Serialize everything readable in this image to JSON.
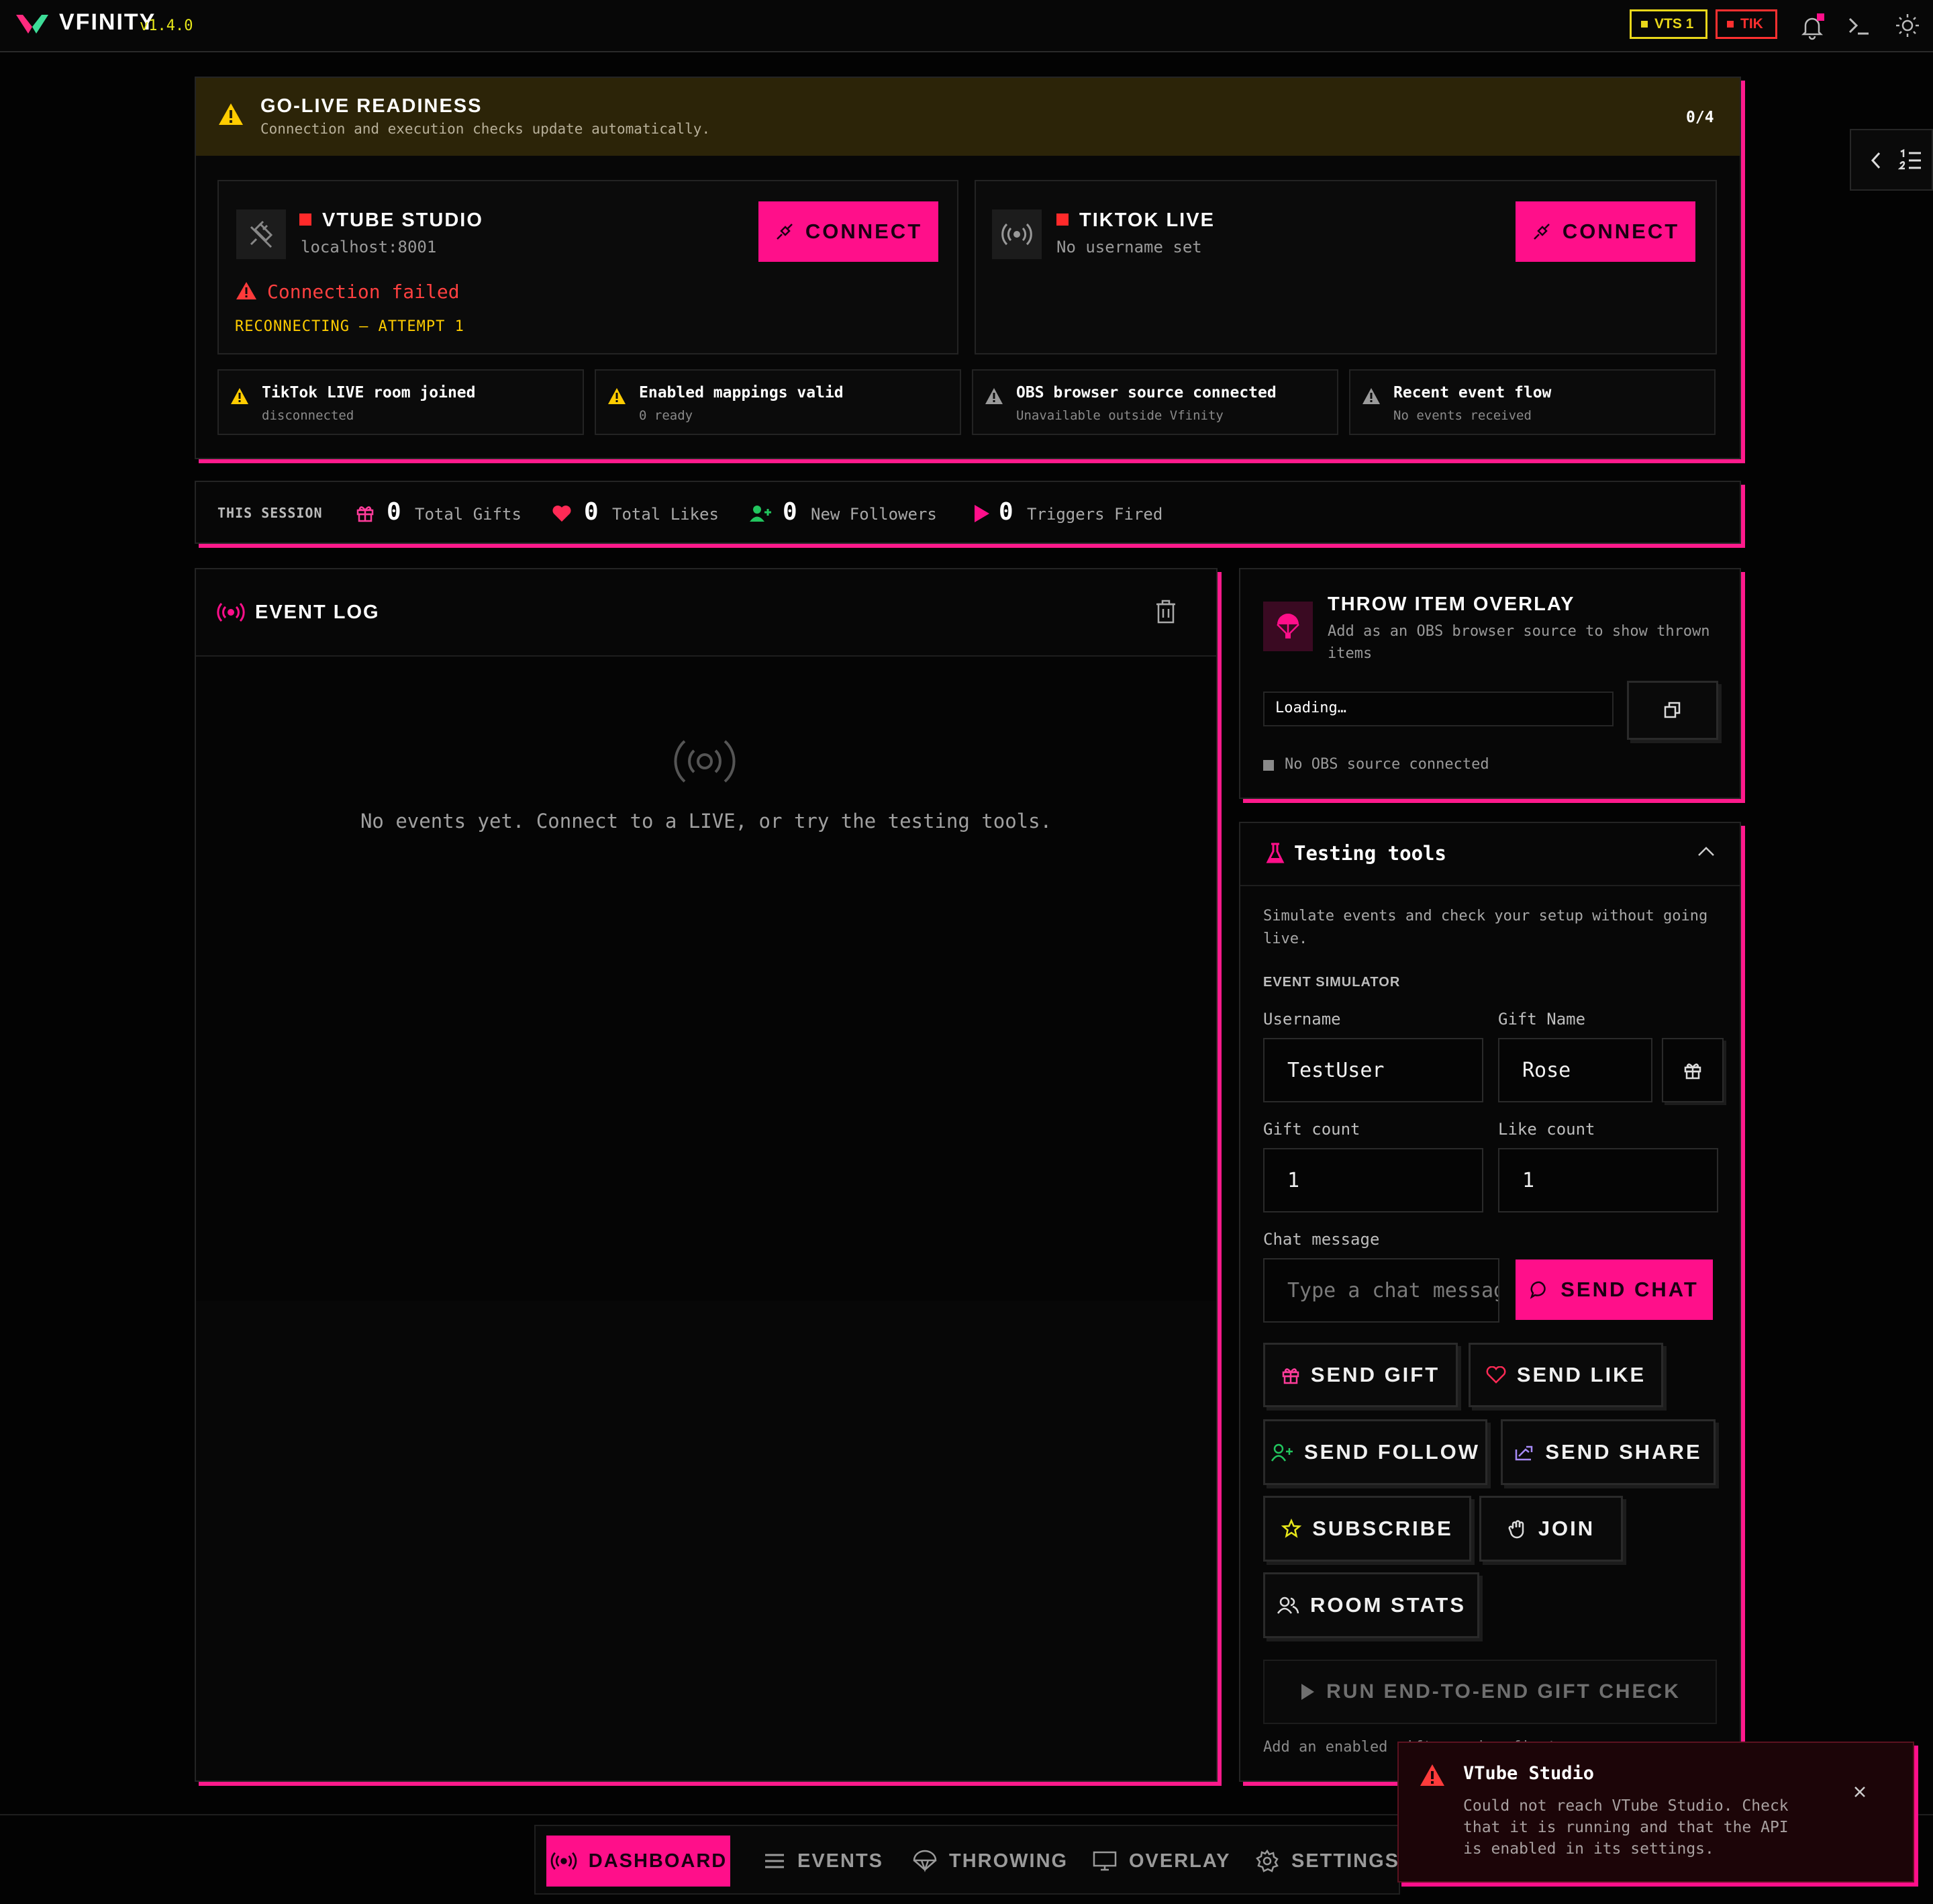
{
  "app": {
    "name": "VFINITY",
    "version": "v1.4.0",
    "status_pills": [
      {
        "label": "VTS 1",
        "color": "#e8d71a"
      },
      {
        "label": "TIK",
        "color": "#ff3030"
      }
    ]
  },
  "readiness": {
    "title": "GO-LIVE READINESS",
    "subtitle": "Connection and execution checks update automatically.",
    "score": "0/4",
    "vtube": {
      "title": "VTUBE STUDIO",
      "address": "localhost:8001",
      "button": "CONNECT",
      "error": "Connection failed",
      "status": "RECONNECTING – ATTEMPT 1"
    },
    "tiktok": {
      "title": "TIKTOK LIVE",
      "address": "No username set",
      "button": "CONNECT"
    },
    "checks": [
      {
        "title": "TikTok LIVE room joined",
        "detail": "disconnected"
      },
      {
        "title": "Enabled mappings valid",
        "detail": "0 ready"
      },
      {
        "title": "OBS browser source connected",
        "detail": "Unavailable outside Vfinity"
      },
      {
        "title": "Recent event flow",
        "detail": "No events received"
      }
    ]
  },
  "session": {
    "label": "THIS SESSION",
    "stats": [
      {
        "value": "0",
        "label": "Total Gifts",
        "icon": "gift-icon",
        "color": "#ff3c9a"
      },
      {
        "value": "0",
        "label": "Total Likes",
        "icon": "heart-icon",
        "color": "#ff2a55"
      },
      {
        "value": "0",
        "label": "New Followers",
        "icon": "user-plus-icon",
        "color": "#22c55e"
      },
      {
        "value": "0",
        "label": "Triggers Fired",
        "icon": "play-icon",
        "color": "#ff0f8a"
      }
    ]
  },
  "event_log": {
    "title": "EVENT LOG",
    "empty": "No events yet. Connect to a LIVE, or try the testing tools."
  },
  "overlay": {
    "title": "THROW ITEM OVERLAY",
    "subtitle": "Add as an OBS browser source to show thrown items",
    "url_value": "Loading…",
    "status": "No OBS source connected"
  },
  "testing": {
    "title": "Testing tools",
    "description": "Simulate events and check your setup without going live.",
    "section": "EVENT SIMULATOR",
    "fields": {
      "username_label": "Username",
      "username_value": "TestUser",
      "gift_name_label": "Gift Name",
      "gift_name_value": "Rose",
      "gift_count_label": "Gift count",
      "gift_count_value": "1",
      "like_count_label": "Like count",
      "like_count_value": "1",
      "chat_label": "Chat message",
      "chat_placeholder": "Type a chat message"
    },
    "buttons": {
      "send_chat": "SEND CHAT",
      "send_gift": "SEND GIFT",
      "send_like": "SEND LIKE",
      "send_follow": "SEND FOLLOW",
      "send_share": "SEND SHARE",
      "subscribe": "SUBSCRIBE",
      "join": "JOIN",
      "room_stats": "ROOM STATS",
      "e2e": "RUN END-TO-END GIFT CHECK"
    },
    "e2e_note": "Add an enabled gift mapping first"
  },
  "nav": {
    "items": [
      {
        "label": "DASHBOARD",
        "active": true
      },
      {
        "label": "EVENTS",
        "active": false
      },
      {
        "label": "THROWING",
        "active": false
      },
      {
        "label": "OVERLAY",
        "active": false
      },
      {
        "label": "SETTINGS",
        "active": false
      }
    ]
  },
  "toast": {
    "title": "VTube Studio",
    "message": "Could not reach VTube Studio. Check that it is running and that the API is enabled in its settings."
  },
  "colors": {
    "accent": "#ff0f8a",
    "warning": "#ffcc00",
    "error": "#ff3b3b",
    "banner_bg": "#2c2408"
  }
}
